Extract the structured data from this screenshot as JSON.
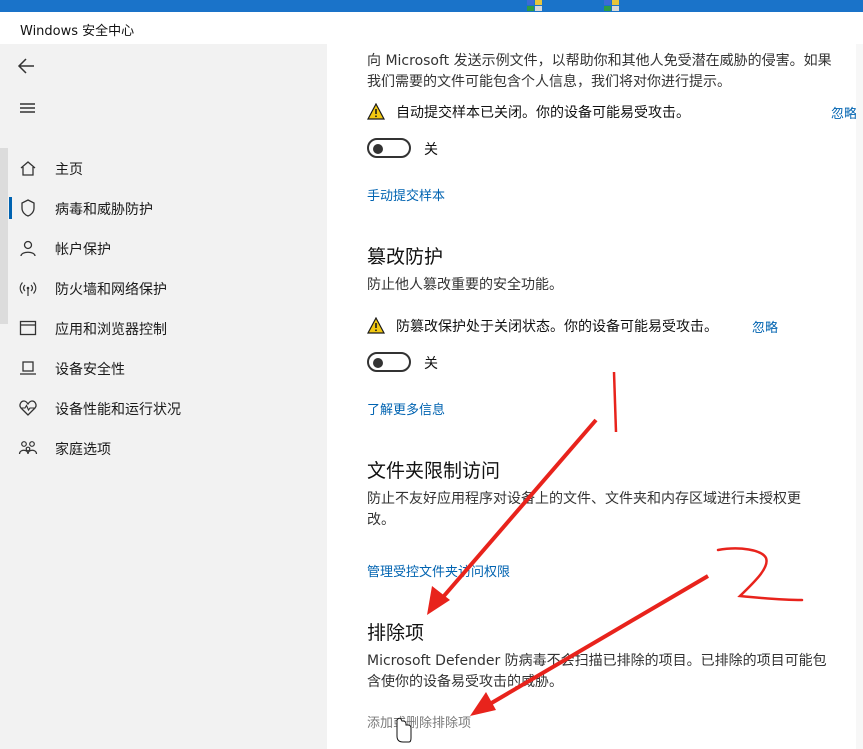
{
  "window": {
    "title": "Windows 安全中心"
  },
  "nav": {
    "back_icon": "back-arrow-icon",
    "menu_icon": "hamburger-menu-icon",
    "items": [
      {
        "label": "主页",
        "icon": "home-icon"
      },
      {
        "label": "病毒和威胁防护",
        "icon": "shield-icon"
      },
      {
        "label": "帐户保护",
        "icon": "person-icon"
      },
      {
        "label": "防火墙和网络保护",
        "icon": "wifi-antenna-icon"
      },
      {
        "label": "应用和浏览器控制",
        "icon": "app-window-icon"
      },
      {
        "label": "设备安全性",
        "icon": "laptop-icon"
      },
      {
        "label": "设备性能和运行状况",
        "icon": "heart-pulse-icon"
      },
      {
        "label": "家庭选项",
        "icon": "family-icon"
      }
    ]
  },
  "sample_submission": {
    "desc_line1": "向 Microsoft 发送示例文件，以帮助你和其他人免受潜在威胁的侵害。如果",
    "desc_line2": "我们需要的文件可能包含个人信息，我们将对你进行提示。",
    "warning": "自动提交样本已关闭。你的设备可能易受攻击。",
    "dismiss": "忽略",
    "toggle_label": "关",
    "toggle_on": false,
    "link": "手动提交样本"
  },
  "tamper_protection": {
    "title": "篡改防护",
    "desc": "防止他人篡改重要的安全功能。",
    "warning": "防篡改保护处于关闭状态。你的设备可能易受攻击。",
    "dismiss": "忽略",
    "toggle_label": "关",
    "toggle_on": false,
    "link": "了解更多信息"
  },
  "folder_access": {
    "title": "文件夹限制访问",
    "desc_line1": "防止不友好应用程序对设备上的文件、文件夹和内存区域进行未授权更",
    "desc_line2": "改。",
    "link": "管理受控文件夹访问权限"
  },
  "exclusions": {
    "title": "排除项",
    "desc_line1": "Microsoft Defender 防病毒不会扫描已排除的项目。已排除的项目可能包",
    "desc_line2": "含使你的设备易受攻击的威胁。",
    "link": "添加或删除排除项"
  },
  "annotations": {
    "mark_1": "1",
    "mark_2": "2",
    "color": "#e8231c"
  },
  "colors": {
    "accent": "#0063b1",
    "warning": "#f2c811",
    "sidebar_bg": "#f2f2f2"
  }
}
